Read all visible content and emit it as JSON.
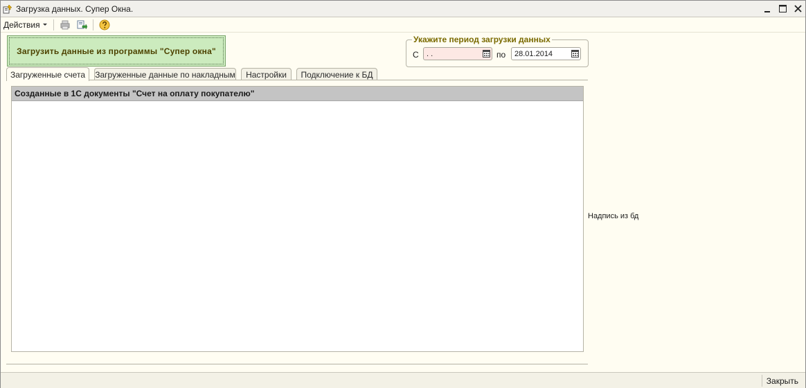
{
  "window": {
    "title": "Загрузка данных. Супер Окна."
  },
  "toolbar": {
    "actions_label": "Действия"
  },
  "load_button": {
    "label": "Загрузить данные из программы \"Супер окна\""
  },
  "period": {
    "legend": "Укажите период загрузки данных",
    "from_label": "С",
    "from_value": " .  .",
    "to_label": "по",
    "to_value": "28.01.2014"
  },
  "tabs": [
    {
      "label": "Загруженные счета",
      "active": true
    },
    {
      "label": "Загруженные данные по накладным",
      "active": false
    },
    {
      "label": "Настройки",
      "active": false
    },
    {
      "label": "Подключение к БД",
      "active": false
    }
  ],
  "panel": {
    "header": "Созданные в 1С документы \"Счет на оплату покупателю\""
  },
  "db_label": "Надпись из бд",
  "footer": {
    "close_label": "Закрыть"
  },
  "colors": {
    "load_button_bg": "#ccebbe",
    "date_from_bg": "#fde8e4",
    "legend_text": "#7a6a00",
    "panel_header_bg": "#c4c4c4"
  }
}
